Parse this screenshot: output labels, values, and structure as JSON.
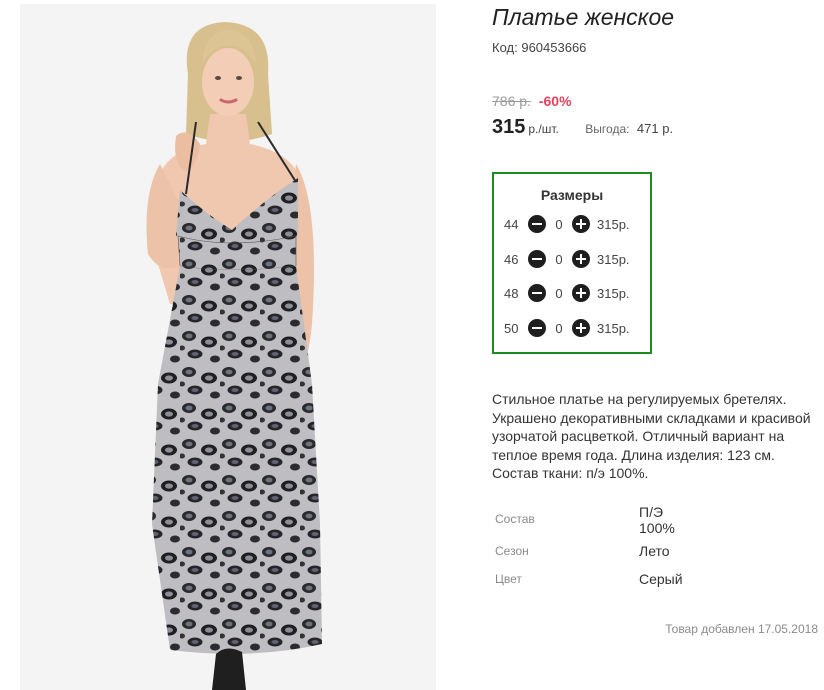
{
  "product": {
    "title": "Платье женское",
    "sku_label": "Код:",
    "sku_value": "960453666"
  },
  "pricing": {
    "old_price": "786 р.",
    "discount": "-60%",
    "price": "315",
    "unit": "р./шт.",
    "savings_label": "Выгода:",
    "savings_value": "471 р."
  },
  "sizes": {
    "title": "Размеры",
    "rows": [
      {
        "size": "44",
        "qty": "0",
        "price": "315р."
      },
      {
        "size": "46",
        "qty": "0",
        "price": "315р."
      },
      {
        "size": "48",
        "qty": "0",
        "price": "315р."
      },
      {
        "size": "50",
        "qty": "0",
        "price": "315р."
      }
    ]
  },
  "description": "Стильное платье на регулируемых бретелях. Украшено декоративными складками и красивой узорчатой расцветкой. Отличный вариант на теплое время года. Длина изделия: 123 см. Состав ткани: п/э 100%.",
  "attributes": [
    {
      "label": "Состав",
      "value_lines": [
        "П/Э",
        "100%"
      ]
    },
    {
      "label": "Сезон",
      "value_lines": [
        "Лето"
      ]
    },
    {
      "label": "Цвет",
      "value_lines": [
        "Серый"
      ]
    }
  ],
  "added": {
    "label": "Товар добавлен",
    "date": "17.05.2018"
  },
  "colors": {
    "accent_green": "#1f8a1f",
    "discount_red": "#e5405e",
    "button_dark": "#1e1e1e",
    "muted_gray": "#8a8a8a"
  },
  "icons": {
    "minus": "minus-circle-icon",
    "plus": "plus-circle-icon"
  }
}
